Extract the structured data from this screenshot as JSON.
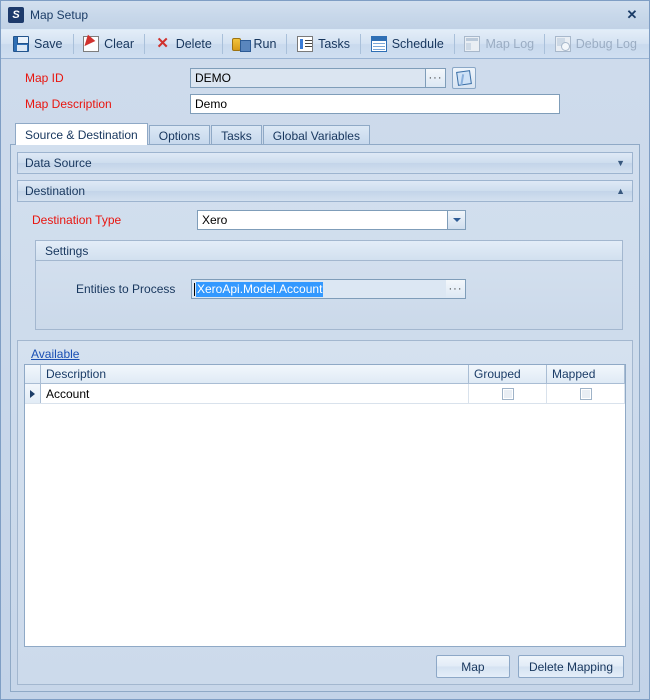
{
  "window": {
    "title": "Map Setup",
    "app_icon": "app-logo-icon",
    "close_label": "✕"
  },
  "toolbar": {
    "items": [
      {
        "label": "Save",
        "icon": "save-icon",
        "disabled": false
      },
      {
        "label": "Clear",
        "icon": "clear-icon",
        "disabled": false
      },
      {
        "label": "Delete",
        "icon": "delete-icon",
        "disabled": false
      },
      {
        "label": "Run",
        "icon": "run-icon",
        "disabled": false
      },
      {
        "label": "Tasks",
        "icon": "tasks-icon",
        "disabled": false
      },
      {
        "label": "Schedule",
        "icon": "schedule-icon",
        "disabled": false
      },
      {
        "label": "Map Log",
        "icon": "map-log-icon",
        "disabled": true
      },
      {
        "label": "Debug Log",
        "icon": "debug-log-icon",
        "disabled": true
      }
    ]
  },
  "form": {
    "map_id_label": "Map ID",
    "map_id_value": "DEMO",
    "map_id_ellipsis": "···",
    "map_id_edit_icon": "notepad-edit-icon",
    "map_description_label": "Map Description",
    "map_description_value": "Demo"
  },
  "tabs": [
    {
      "label": "Source & Destination",
      "active": true
    },
    {
      "label": "Options",
      "active": false
    },
    {
      "label": "Tasks",
      "active": false
    },
    {
      "label": "Global Variables",
      "active": false
    }
  ],
  "panels": {
    "data_source": {
      "title": "Data Source",
      "expanded": false,
      "chevron": "▼"
    },
    "destination": {
      "title": "Destination",
      "expanded": true,
      "chevron": "▲"
    }
  },
  "destination": {
    "type_label": "Destination Type",
    "type_value": "Xero",
    "settings_title": "Settings",
    "entities_label": "Entities to Process",
    "entities_value": "XeroApi.Model.Account",
    "entities_ellipsis": "···"
  },
  "available": {
    "link_label": "Available ",
    "columns": [
      "",
      "Description",
      "Grouped",
      "Mapped"
    ],
    "rows": [
      {
        "selected": true,
        "description": "Account",
        "grouped": false,
        "mapped": false
      }
    ]
  },
  "actions": {
    "map_label": "Map",
    "delete_mapping_label": "Delete Mapping"
  },
  "colors": {
    "required_label": "#e8150f",
    "link": "#1a4fb4",
    "selection": "#3399ff",
    "window_bg": "#c7d6e9",
    "accent": "#2f6fb5"
  }
}
